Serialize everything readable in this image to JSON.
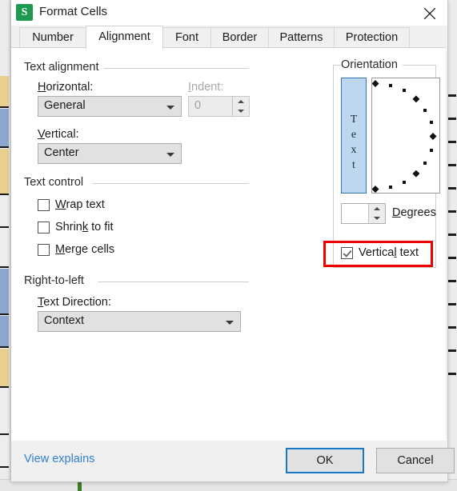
{
  "window": {
    "title": "Format Cells",
    "app_icon": "spreadsheet-icon",
    "app_icon_letter": "S",
    "app_icon_color": "#1f9950",
    "close_icon": "close-icon"
  },
  "tabs": [
    {
      "label": "Number",
      "active": false
    },
    {
      "label": "Alignment",
      "active": true
    },
    {
      "label": "Font",
      "active": false
    },
    {
      "label": "Border",
      "active": false
    },
    {
      "label": "Patterns",
      "active": false
    },
    {
      "label": "Protection",
      "active": false
    }
  ],
  "text_alignment": {
    "group_label": "Text alignment",
    "horizontal_label": "Horizontal:",
    "horizontal_value": "General",
    "vertical_label": "Vertical:",
    "vertical_value": "Center",
    "indent_label": "Indent:",
    "indent_value": "0",
    "indent_disabled": true
  },
  "text_control": {
    "group_label": "Text control",
    "items": [
      {
        "label": "Wrap text",
        "checked": false
      },
      {
        "label": "Shrink to fit",
        "checked": false
      },
      {
        "label": "Merge cells",
        "checked": false
      }
    ]
  },
  "right_to_left": {
    "group_label": "Right-to-left",
    "direction_label": "Text Direction:",
    "direction_value": "Context"
  },
  "orientation": {
    "group_label": "Orientation",
    "text_sample": "Text",
    "text_sample_letters": [
      "T",
      "e",
      "x",
      "t"
    ],
    "text_sample_selected": true,
    "degrees_value": "",
    "degrees_label": "Degrees",
    "vertical_text_label": "Vertical text",
    "vertical_text_checked": true,
    "highlight_color": "#ee0000",
    "highlighted_control": "vertical-text-checkbox"
  },
  "footer": {
    "help_link": "View explains",
    "ok_label": "OK",
    "cancel_label": "Cancel",
    "default_button": "OK"
  },
  "background_sheet": {
    "left_cell_colors": [
      "#e8cf8f",
      "#8ba6d0",
      "#e8cf8f",
      "#ededed",
      "#ededed",
      "#8ba6d0",
      "#8ba6d0",
      "#e8cf8f",
      "#ededed",
      "#ededed"
    ],
    "accent_green": "#3a7d22"
  }
}
